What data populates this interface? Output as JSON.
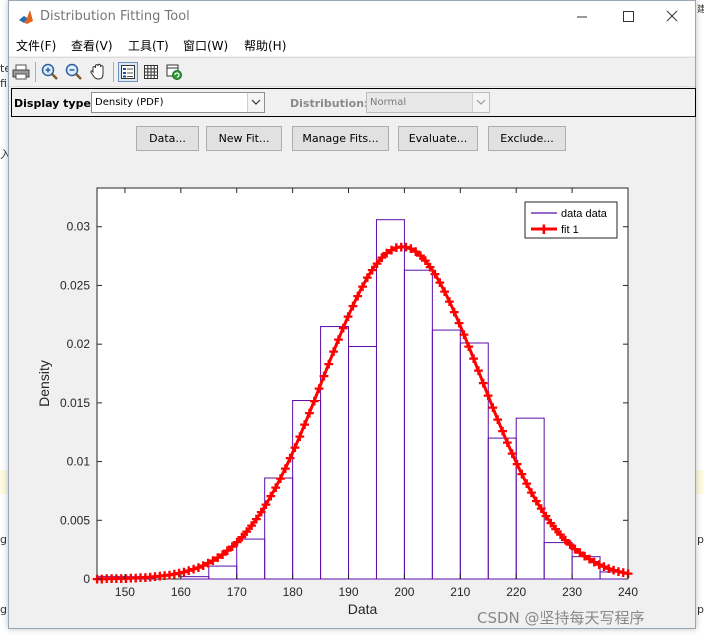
{
  "window": {
    "title": "Distribution Fitting Tool",
    "minimize_glyph": "—",
    "maximize_glyph": "☐",
    "close_glyph": "✕"
  },
  "menu": [
    "文件(F)",
    "查看(V)",
    "工具(T)",
    "窗口(W)",
    "帮助(H)"
  ],
  "toolbar": {
    "icons": [
      "print-icon",
      "zoom-in-icon",
      "zoom-out-icon",
      "pan-hand-icon",
      "legend-toggle-icon",
      "grid-toggle-icon",
      "restore-view-icon"
    ],
    "selected": "legend-toggle-icon"
  },
  "display_type": {
    "label": "Display type:",
    "value": "Density (PDF)"
  },
  "distribution": {
    "label": "Distribution:",
    "value": "Normal"
  },
  "buttons": [
    "Data...",
    "New Fit...",
    "Manage Fits...",
    "Evaluate...",
    "Exclude..."
  ],
  "background_fragments": [
    "te",
    "fi",
    "入",
    "g",
    "g",
    "p",
    "p",
    "g",
    "建"
  ],
  "watermark": "CSDN @坚持每天写程序",
  "colors": {
    "histogram": "#5b0fa8",
    "fit": "#ff0000",
    "selected_tool": "#dbe6f6"
  },
  "chart_data": {
    "type": "bar",
    "xlabel": "Data",
    "ylabel": "Density",
    "xlim": [
      145,
      240
    ],
    "ylim": [
      0,
      0.0333
    ],
    "xticks": [
      150,
      160,
      170,
      180,
      190,
      200,
      210,
      220,
      230,
      240
    ],
    "yticks": [
      0,
      0.005,
      0.01,
      0.015,
      0.02,
      0.025,
      0.03
    ],
    "ytick_labels": [
      "0",
      "0.005",
      "0.01",
      "0.015",
      "0.02",
      "0.025",
      "0.03"
    ],
    "legend_position": "top-right",
    "series": [
      {
        "name": "data data",
        "kind": "histogram",
        "bin_edges": [
          145,
          150,
          155,
          160,
          165,
          170,
          175,
          180,
          185,
          190,
          195,
          200,
          205,
          210,
          215,
          220,
          225,
          230,
          235,
          240
        ],
        "values": [
          0.0002,
          0.0002,
          0.0,
          0.0002,
          0.0011,
          0.0034,
          0.0086,
          0.0152,
          0.0215,
          0.0198,
          0.0306,
          0.0263,
          0.0212,
          0.0201,
          0.012,
          0.0137,
          0.0031,
          0.0019,
          0.0006
        ]
      },
      {
        "name": "fit 1",
        "kind": "normal-pdf",
        "mu": 199.6,
        "sigma": 14.1
      }
    ]
  }
}
